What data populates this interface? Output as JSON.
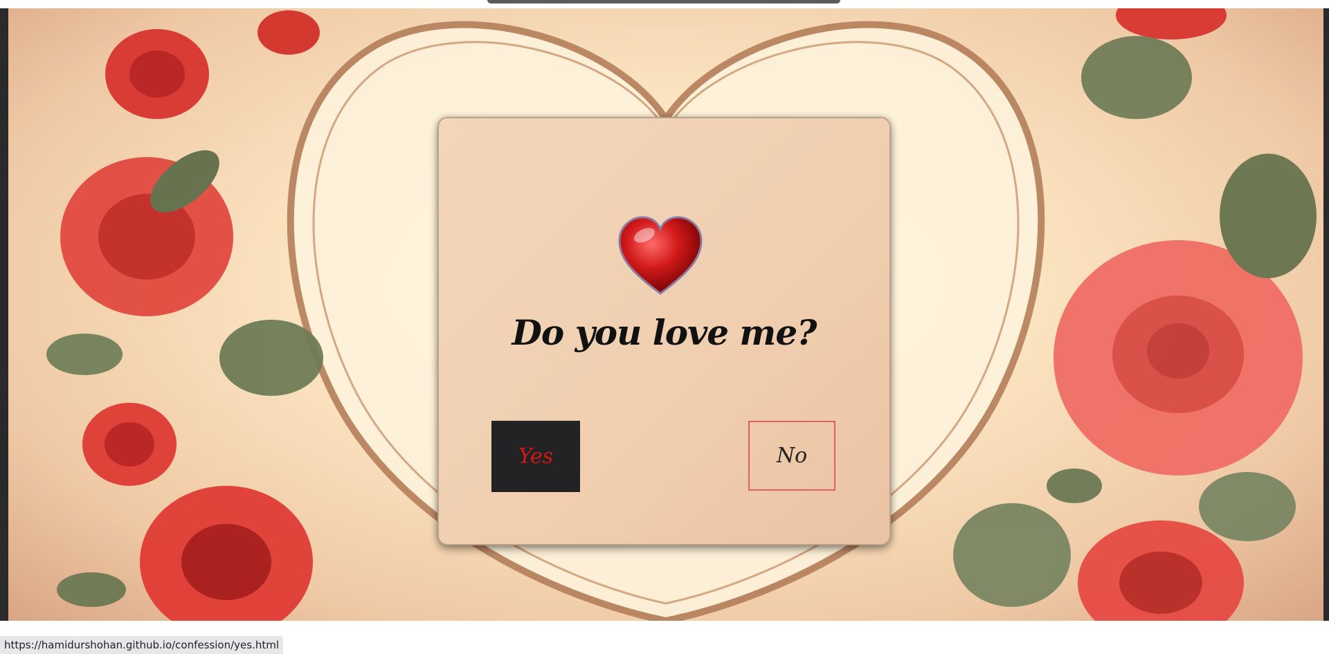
{
  "page": {
    "question": "Do you love me?",
    "yes_label": "Yes",
    "no_label": "No"
  },
  "status_bar": {
    "url": "https://hamidurshohan.github.io/confession/yes.html"
  },
  "icons": {
    "heart": "heart-icon"
  },
  "colors": {
    "yes_bg": "#232325",
    "yes_text": "#d51616",
    "no_border": "#e06060",
    "card_bg": "#f0cfb0",
    "rose": "#d8352f"
  }
}
